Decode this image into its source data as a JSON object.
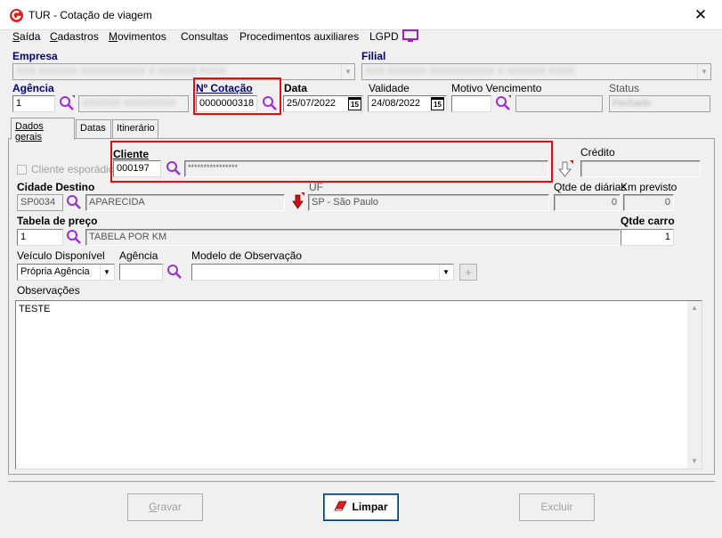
{
  "window": {
    "title": "TUR - Cotação de viagem",
    "close_label": "✕"
  },
  "menu": [
    {
      "label": "Saída",
      "underline": "S",
      "rest": "aída"
    },
    {
      "label": "Cadastros",
      "underline": "C",
      "rest": "adastros"
    },
    {
      "label": "Movimentos",
      "underline": "M",
      "rest": "ovimentos"
    },
    {
      "label": "Consultas",
      "underline": "",
      "rest": "Consultas"
    },
    {
      "label": "Procedimentos auxiliares",
      "underline": "",
      "rest": "Procedimentos auxiliares"
    },
    {
      "label": "LGPD",
      "underline": "",
      "rest": "LGPD"
    }
  ],
  "header": {
    "empresa_label": "Empresa",
    "empresa_value": "XXX XXXXXX XXXXXXXXXX X XXXXXX XXXX",
    "filial_label": "Filial",
    "filial_value": "XXX XXXXXX XXXXXXXXXX X XXXXXX XXXX",
    "agencia_label": "Agência",
    "agencia_code": "1",
    "agencia_name": "XXXXXX XXXXXXXX",
    "cotacao_label": "Nº Cotação",
    "cotacao_value": "0000000318",
    "data_label": "Data",
    "data_value": "25/07/2022",
    "validade_label": "Validade",
    "validade_value": "24/08/2022",
    "motivo_label": "Motivo Vencimento",
    "motivo_value": "",
    "status_label": "Status",
    "status_value": "Fechado",
    "calendar_glyph": "15"
  },
  "tabs": [
    {
      "label": "Dados gerais",
      "active": true
    },
    {
      "label": "Datas",
      "active": false
    },
    {
      "label": "Itinerário",
      "active": false
    }
  ],
  "dados_gerais": {
    "cliente_esporadico_label": "Cliente esporádico",
    "cliente_label": "Cliente",
    "cliente_code": "000197",
    "cliente_name": "****************",
    "credito_label": "Crédito",
    "credito_value": "",
    "cidade_label": "Cidade Destino",
    "cidade_code": "SP0034",
    "cidade_name": "APARECIDA",
    "uf_label": "UF",
    "uf_value": "SP - São Paulo",
    "qtde_diarias_label": "Qtde de diárias",
    "qtde_diarias_value": "0",
    "km_previsto_label": "Km previsto",
    "km_previsto_value": "0",
    "tabela_label": "Tabela de preço",
    "tabela_code": "1",
    "tabela_name": "TABELA POR KM",
    "qtde_carro_label": "Qtde carro",
    "qtde_carro_value": "1",
    "veiculo_label": "Veículo Disponível",
    "veiculo_value": "Própria Agência",
    "agencia2_label": "Agência",
    "agencia2_value": "",
    "modelo_obs_label": "Modelo de Observação",
    "modelo_obs_value": "",
    "observacoes_label": "Observações",
    "observacoes_value": "TESTE"
  },
  "buttons": {
    "gravar": "Gravar",
    "limpar": "Limpar",
    "excluir": "Excluir"
  },
  "colors": {
    "label_blue": "#000080",
    "highlight_red": "#e01010",
    "search_purple": "#9b30d0"
  }
}
